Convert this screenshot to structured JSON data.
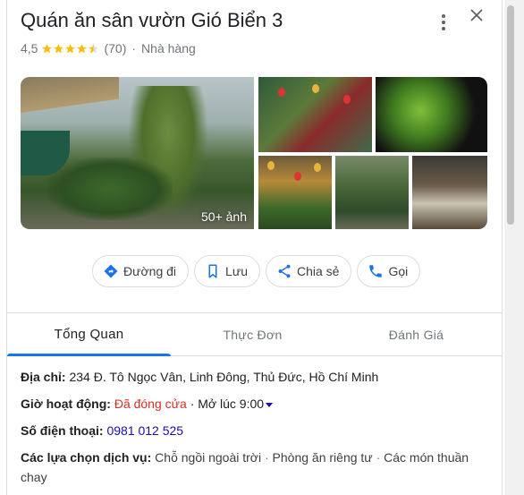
{
  "place": {
    "name": "Quán ăn sân vườn Gió Biển 3",
    "rating": "4,5",
    "stars": 4.5,
    "review_count": "(70)",
    "separator": "·",
    "category": "Nhà hàng"
  },
  "photos": {
    "count_label": "50+ ảnh"
  },
  "actions": {
    "directions": "Đường đi",
    "save": "Lưu",
    "share": "Chia sẻ",
    "call": "Gọi"
  },
  "tabs": [
    {
      "label": "Tổng Quan",
      "active": true
    },
    {
      "label": "Thực Đơn",
      "active": false
    },
    {
      "label": "Đánh Giá",
      "active": false
    }
  ],
  "info": {
    "address_label": "Địa chỉ:",
    "address_value": "234 Đ. Tô Ngọc Vân, Linh Đông, Thủ Đức, Hồ Chí Minh",
    "hours_label": "Giờ hoạt động:",
    "hours_status": "Đã đóng cửa",
    "hours_sep": "·",
    "hours_open": "Mở lúc 9:00",
    "phone_label": "Số điện thoại:",
    "phone_value": "0981 012 525",
    "services_label": "Các lựa chọn dịch vụ:",
    "services": [
      "Chỗ ngồi ngoài trời",
      "Phòng ăn riêng tư",
      "Các món thuần chay"
    ],
    "services_sep": "·"
  },
  "colors": {
    "accent": "#1a73e8",
    "star": "#fbbc04",
    "closed": "#d93025",
    "link": "#1a0dab"
  }
}
